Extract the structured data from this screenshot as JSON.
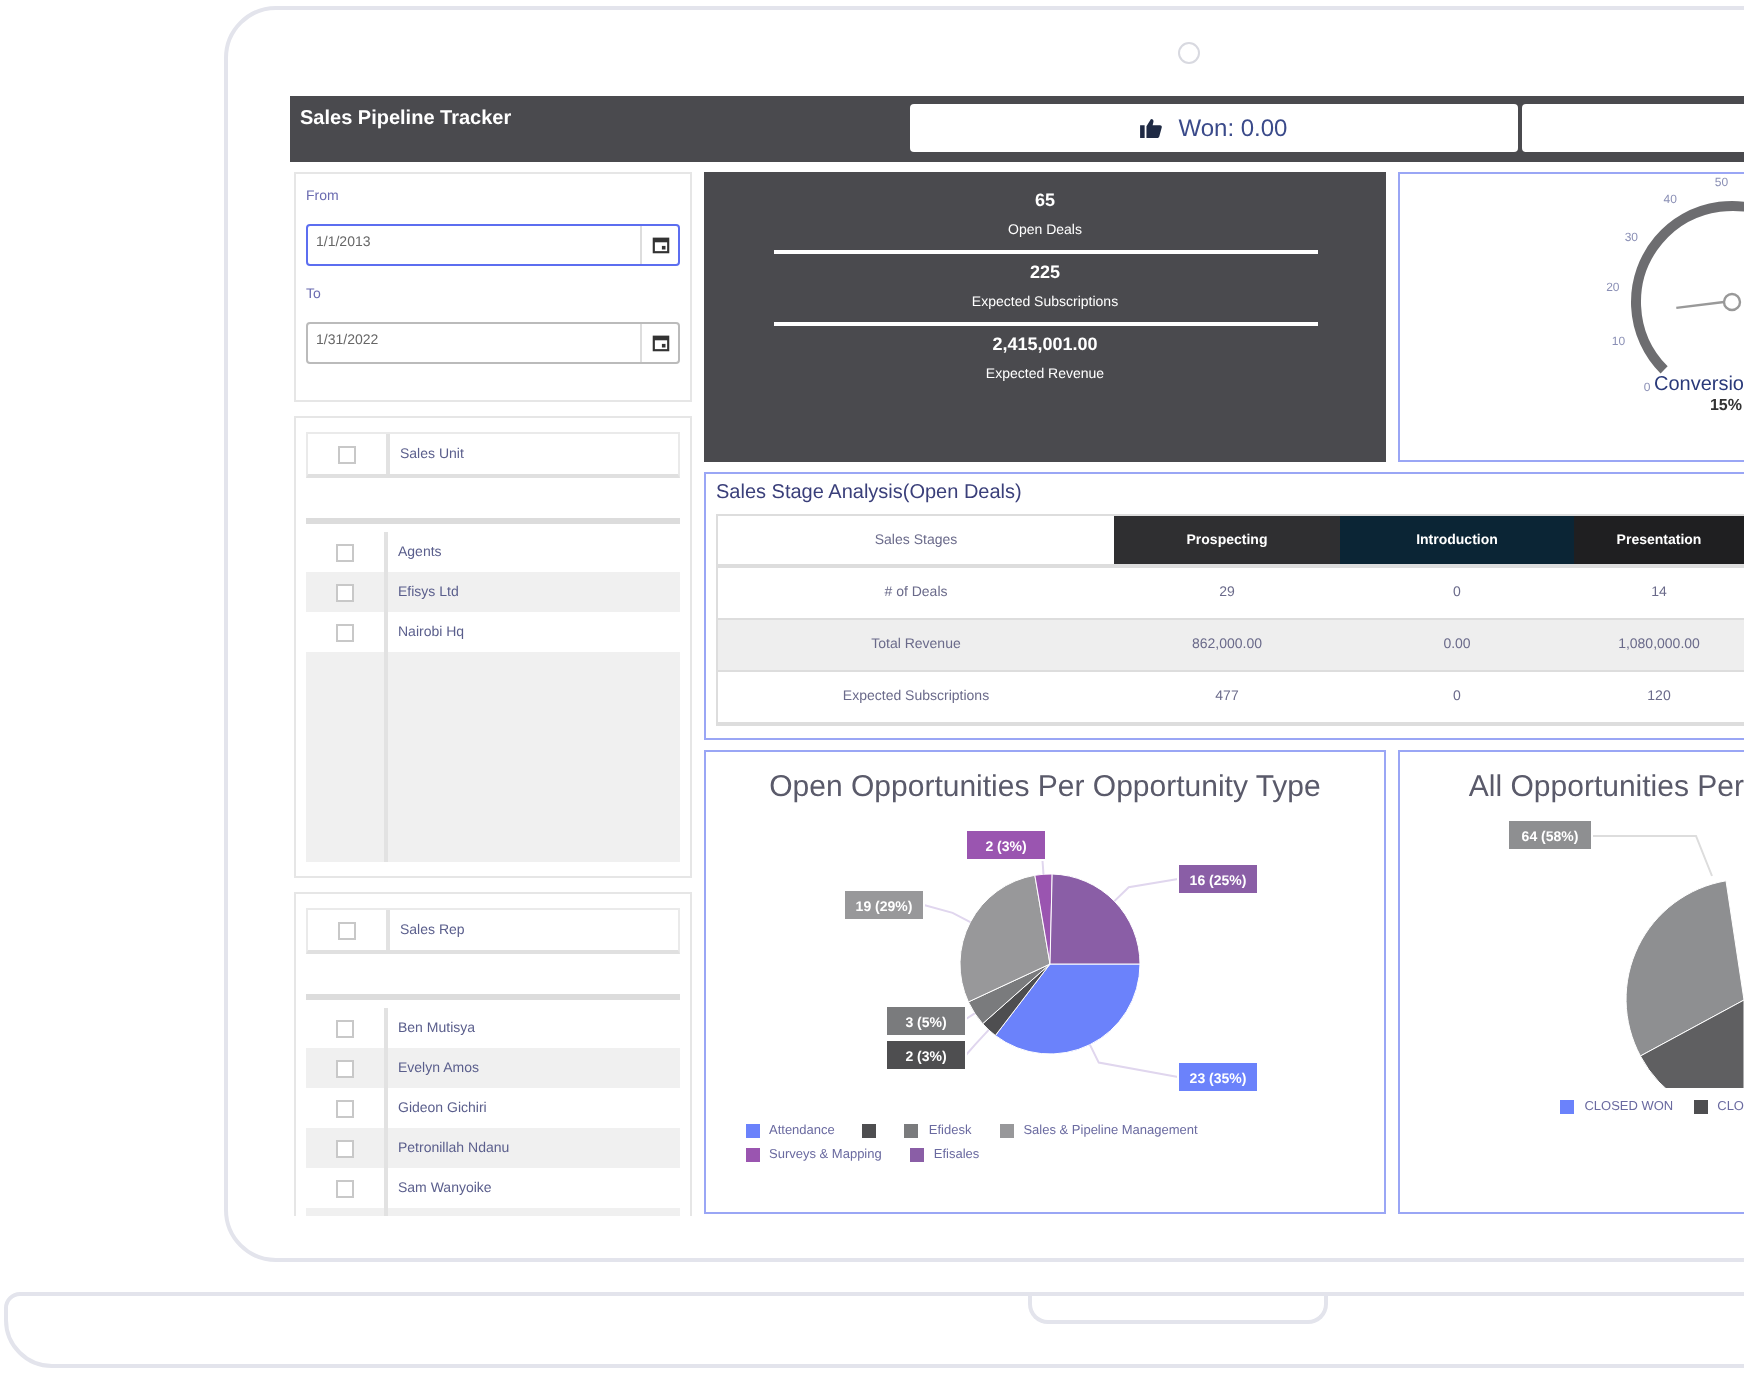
{
  "header": {
    "title": "Sales Pipeline Tracker",
    "won": "Won: 0.00"
  },
  "filters": [
    {
      "label": "From",
      "value": "1/1/2013",
      "focused": true
    },
    {
      "label": "To",
      "value": "1/31/2022",
      "focused": false
    }
  ],
  "lists": [
    {
      "header": "Sales Unit",
      "all_checked": false,
      "rows": [
        {
          "name": "Agents",
          "checked": false
        },
        {
          "name": "Efisys Ltd",
          "checked": false
        },
        {
          "name": "Nairobi Hq",
          "checked": false
        }
      ]
    },
    {
      "header": "Sales Rep",
      "all_checked": false,
      "rows": [
        {
          "name": "Ben Mutisya",
          "checked": false
        },
        {
          "name": "Evelyn Amos",
          "checked": false
        },
        {
          "name": "Gideon Gichiri",
          "checked": false
        },
        {
          "name": "Petronillah Ndanu",
          "checked": false
        },
        {
          "name": "Sam Wanyoike",
          "checked": false
        }
      ]
    }
  ],
  "kpis": [
    {
      "value": "65",
      "label": "Open Deals"
    },
    {
      "value": "225",
      "label": "Expected Subscriptions"
    },
    {
      "value": "2,415,001.00",
      "label": "Expected Revenue"
    }
  ],
  "gauge": {
    "ticks": [
      "0",
      "10",
      "20",
      "30",
      "40",
      "50"
    ],
    "level": 0.15,
    "label": "Conversio",
    "reading": "15%"
  },
  "stage_table": {
    "title": "Sales Stage Analysis(Open Deals)",
    "columns": [
      {
        "label": "Sales Stages",
        "color": "#ffffff"
      },
      {
        "label": "Prospecting",
        "color": "#2f2f31"
      },
      {
        "label": "Introduction",
        "color": "#0b2535"
      },
      {
        "label": "Presentation",
        "color": "#1f1f21"
      }
    ],
    "rows": [
      [
        "# of Deals",
        "29",
        "0",
        "14"
      ],
      [
        "Total Revenue",
        "862,000.00",
        "0.00",
        "1,080,000.00"
      ],
      [
        "Expected Subscriptions",
        "477",
        "0",
        "120"
      ]
    ]
  },
  "open_chart": {
    "chart_data": {
      "type": "pie",
      "title": "Open Opportunities Per Opportunity Type",
      "categories": [
        "Attendance",
        null,
        "Efidesk",
        "Sales & Pipeline Management",
        "Surveys & Mapping",
        "Efisales"
      ],
      "values": [
        23,
        2,
        3,
        19,
        2,
        16
      ],
      "colors": [
        "#6b82fb",
        "#4e4e50",
        "#7a7b7d",
        "#98989a",
        "#9a55b0",
        "#8a5ea6"
      ],
      "value_labels": [
        "23 (35%)",
        "2 (3%)",
        "3 (5%)",
        "19 (29%)",
        "2 (3%)",
        "16 (25%)"
      ]
    }
  },
  "all_chart": {
    "title": "All Opportunities Per",
    "slice_label": "64 (58%)",
    "legend": [
      {
        "name": "CLOSED WON",
        "color": "#6b82fb"
      },
      {
        "name": "CLO",
        "color": "#4e4e50"
      }
    ]
  }
}
